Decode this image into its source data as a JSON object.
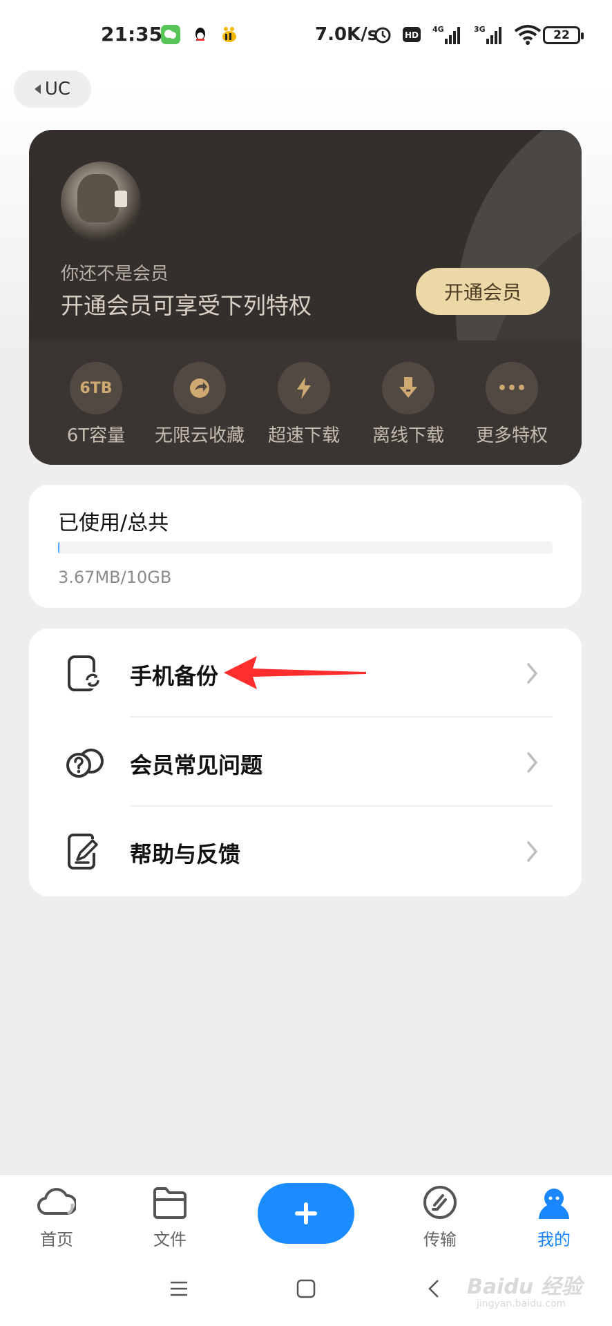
{
  "status_bar": {
    "time": "21:35",
    "net_speed": "7.0K/s",
    "battery": "22",
    "icons": [
      "wechat-notif-icon",
      "qq-icon",
      "bee-app-icon",
      "alarm-icon",
      "hd-icon",
      "signal-4g-icon",
      "signal-3g-icon",
      "wifi-icon"
    ]
  },
  "back": {
    "label": "UC"
  },
  "member_card": {
    "status_text": "你还不是会员",
    "slogan": "开通会员可享受下列特权",
    "open_button": "开通会员",
    "perks": [
      {
        "icon_text": "6TB",
        "label": "6T容量"
      },
      {
        "icon_text": "",
        "label": "无限云收藏"
      },
      {
        "icon_text": "",
        "label": "超速下载"
      },
      {
        "icon_text": "",
        "label": "离线下载"
      },
      {
        "icon_text": "•••",
        "label": "更多特权"
      }
    ]
  },
  "storage": {
    "title": "已使用/总共",
    "usage_text": "3.67MB/10GB",
    "used_fraction": 0.0004,
    "bar_color": "#4da3ff"
  },
  "menu": {
    "items": [
      {
        "label": "手机备份",
        "icon": "phone-backup-icon"
      },
      {
        "label": "会员常见问题",
        "icon": "faq-icon"
      },
      {
        "label": "帮助与反馈",
        "icon": "feedback-icon"
      }
    ]
  },
  "bottom_nav": {
    "items": [
      {
        "label": "首页",
        "icon": "cloud-icon",
        "active": false
      },
      {
        "label": "文件",
        "icon": "folder-icon",
        "active": false
      },
      {
        "label": "传输",
        "icon": "transfer-icon",
        "active": false
      },
      {
        "label": "我的",
        "icon": "profile-icon",
        "active": true
      }
    ],
    "accent_color": "#1a86ff"
  },
  "watermark": {
    "text": "Baidu 经验",
    "sub": "jingyan.baidu.com"
  }
}
